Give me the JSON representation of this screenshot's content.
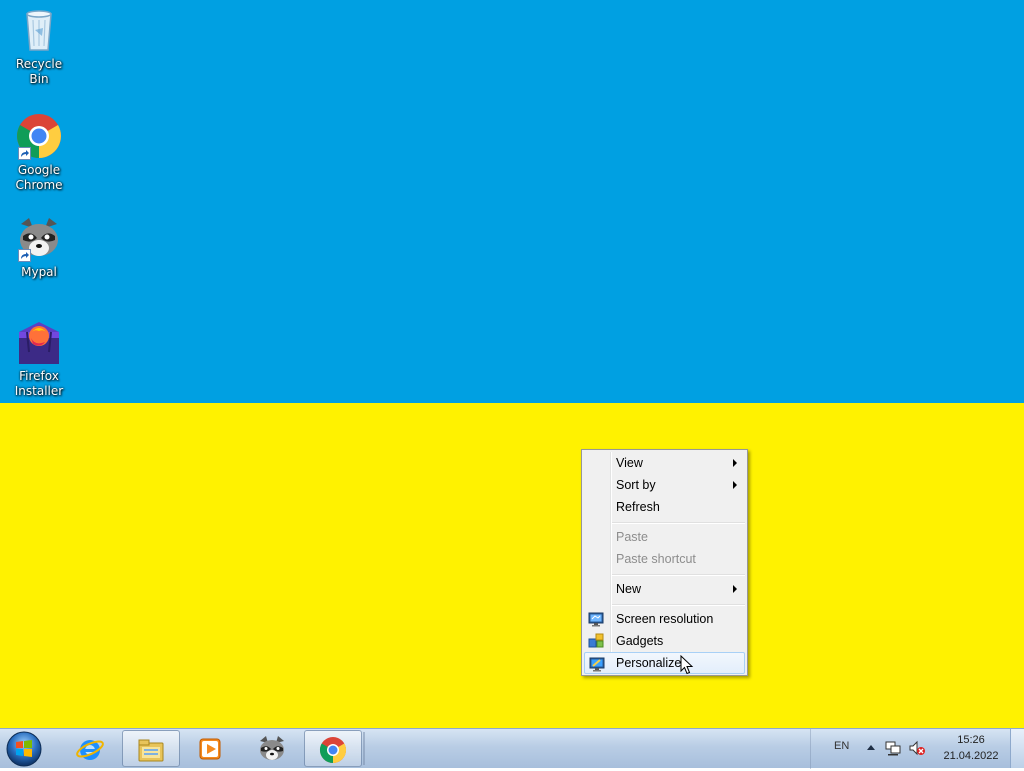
{
  "desktop": {
    "colors": {
      "sky": "#00a0e2",
      "wheat": "#fff200"
    },
    "icons": [
      {
        "name": "recycle-bin",
        "label": "Recycle Bin",
        "icon": "recycle-bin-icon"
      },
      {
        "name": "google-chrome",
        "label": "Google Chrome",
        "icon": "chrome-icon",
        "shortcut": true
      },
      {
        "name": "mypal",
        "label": "Mypal",
        "icon": "raccoon-icon",
        "shortcut": true
      },
      {
        "name": "firefox-installer",
        "label": "Firefox Installer",
        "icon": "firefox-installer-icon"
      }
    ]
  },
  "context_menu": {
    "items": [
      {
        "label": "View",
        "submenu": true
      },
      {
        "label": "Sort by",
        "submenu": true
      },
      {
        "label": "Refresh"
      },
      {
        "label": "Paste",
        "disabled": true
      },
      {
        "label": "Paste shortcut",
        "disabled": true
      },
      {
        "label": "New",
        "submenu": true
      },
      {
        "label": "Screen resolution",
        "icon": "monitor-icon"
      },
      {
        "label": "Gadgets",
        "icon": "gadgets-icon"
      },
      {
        "label": "Personalize",
        "icon": "personalize-icon",
        "highlighted": true
      }
    ]
  },
  "taskbar": {
    "pinned": [
      "start-orb-icon",
      "internet-explorer-icon",
      "file-explorer-icon",
      "media-player-icon",
      "raccoon-icon",
      "chrome-icon"
    ],
    "tray": {
      "language": "EN",
      "time": "15:26",
      "date": "21.04.2022"
    }
  }
}
